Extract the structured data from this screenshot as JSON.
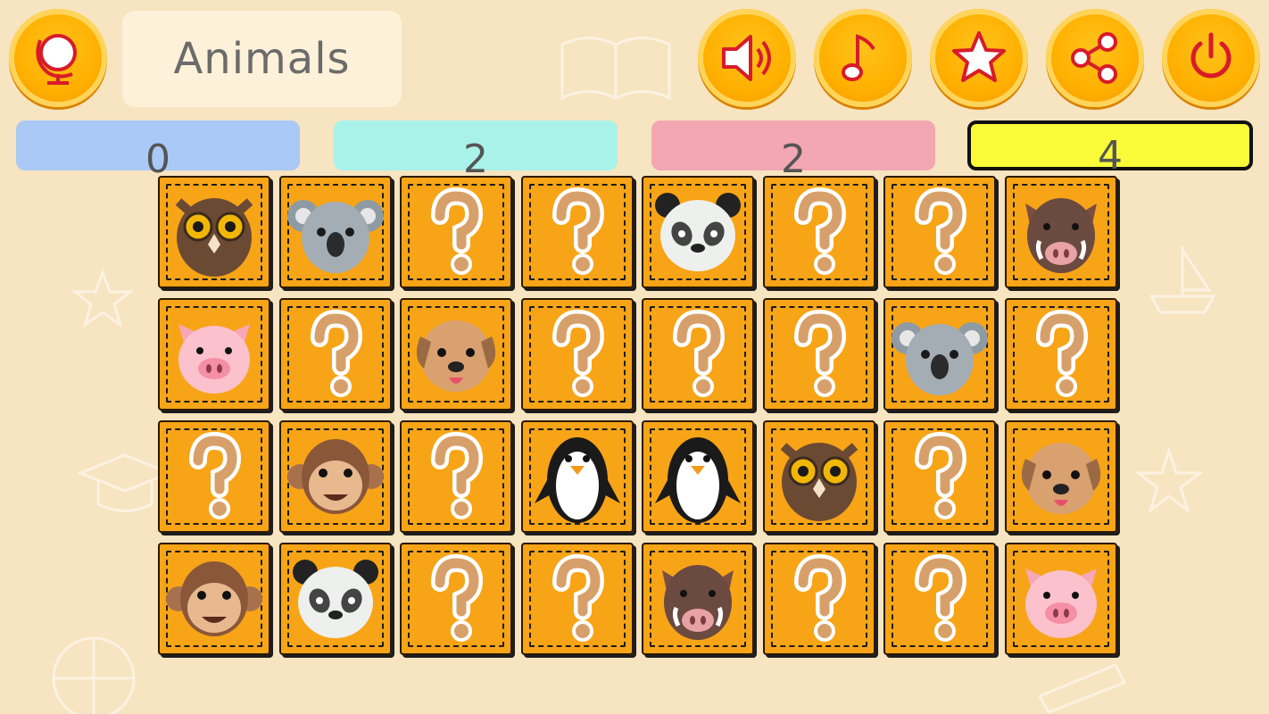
{
  "header": {
    "category_title": "Animals",
    "buttons": {
      "globe": "globe-icon",
      "sound": "speaker-icon",
      "music": "music-note-icon",
      "rate": "star-icon",
      "share": "share-icon",
      "power": "power-icon"
    }
  },
  "scores": [
    {
      "value": "0",
      "color": "#aac9f7",
      "highlight": false
    },
    {
      "value": "2",
      "color": "#a9f2ea",
      "highlight": false
    },
    {
      "value": "2",
      "color": "#f3a7b2",
      "highlight": false
    },
    {
      "value": "4",
      "color": "#f9fb38",
      "highlight": true
    }
  ],
  "board": {
    "rows": 4,
    "cols": 8,
    "cards": [
      "owl",
      "koala",
      "hidden",
      "hidden",
      "panda",
      "hidden",
      "hidden",
      "boar",
      "pig",
      "hidden",
      "dog",
      "hidden",
      "hidden",
      "hidden",
      "koala",
      "hidden",
      "hidden",
      "monkey",
      "hidden",
      "penguin",
      "penguin",
      "owl",
      "hidden",
      "dog",
      "monkey",
      "panda",
      "hidden",
      "hidden",
      "boar",
      "hidden",
      "hidden",
      "pig"
    ]
  },
  "colors": {
    "background": "#f7e4c0",
    "card": "#f8a417",
    "button": "#ffb000",
    "icon_red": "#d81b2a"
  }
}
